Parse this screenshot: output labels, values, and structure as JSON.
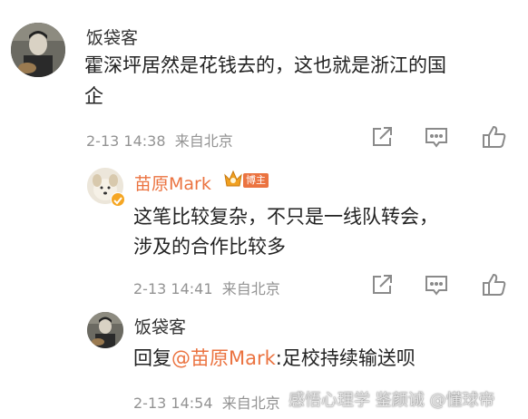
{
  "comments": [
    {
      "author": "饭袋客",
      "text_line1": "霍深坪居然是花钱去的，这也就是浙江的国",
      "text_line2": "企",
      "time": "2-13 14:38",
      "location": "来自北京"
    }
  ],
  "replies": [
    {
      "author": "苗原Mark",
      "badge": "博主",
      "text_line1": "这笔比较复杂，不只是一线队转会，",
      "text_line2": "涉及的合作比较多",
      "time": "2-13 14:41",
      "location": "来自北京"
    },
    {
      "author": "饭袋客",
      "reply_prefix": "回复",
      "mention": "@苗原Mark",
      "reply_text": ":足校持续输送呗",
      "time": "2-13 14:54",
      "location": "来自北京"
    }
  ],
  "watermark": "感悟心理学 鉴颜诚 @懂球帝",
  "icons": [
    "share-icon",
    "comment-icon",
    "like-icon"
  ],
  "colors": {
    "accent": "#eb7340",
    "meta": "#939393",
    "icon": "#8a8a8a"
  }
}
